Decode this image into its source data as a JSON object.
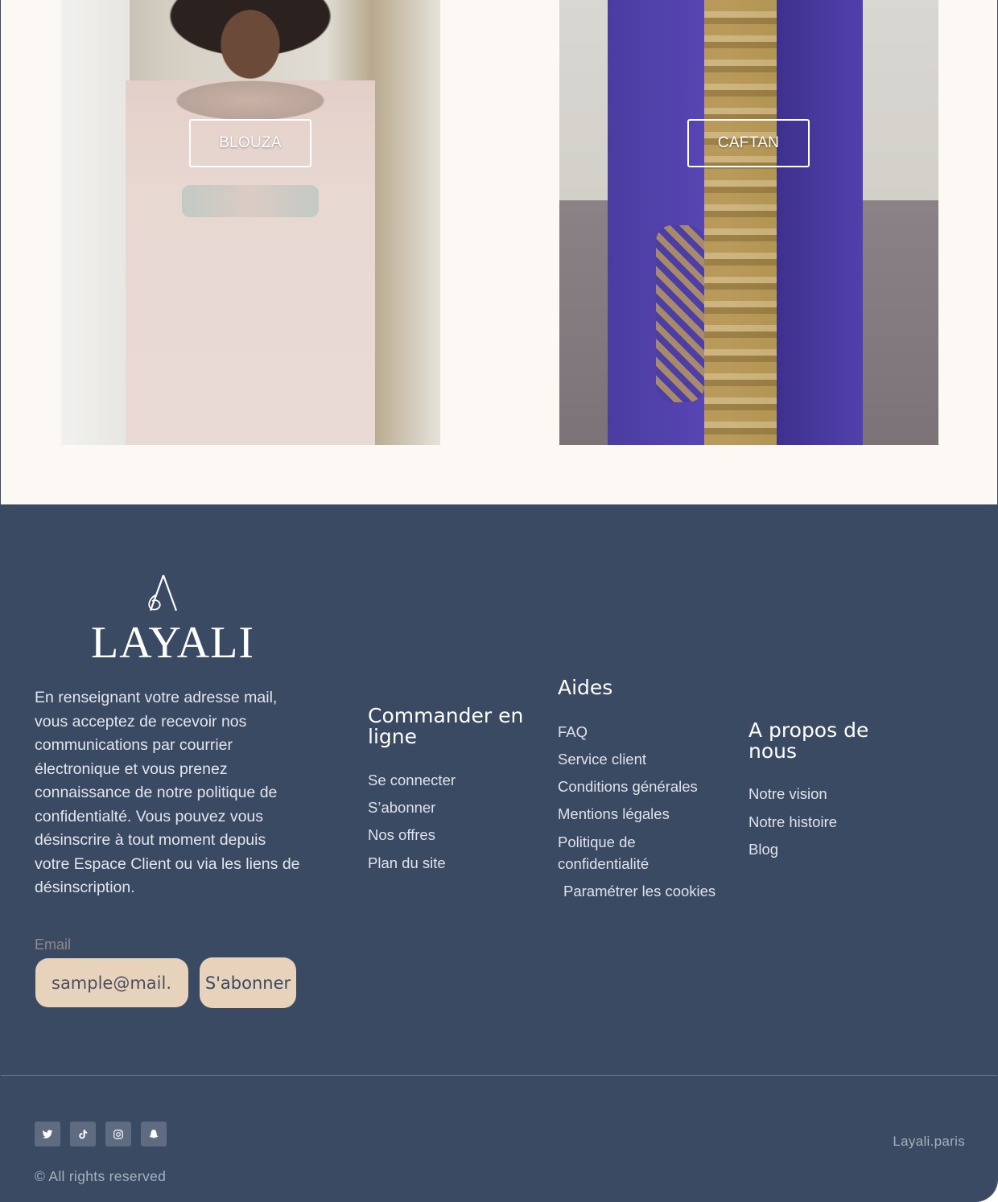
{
  "products": [
    {
      "label": "BLOUZA"
    },
    {
      "label": "CAFTAN"
    }
  ],
  "footer": {
    "logo_text": "LAYALI",
    "intro": "En renseignant votre adresse mail, vous acceptez de recevoir nos communications par courrier électronique et vous prenez connaissance de notre politique de confidentialté. Vous pouvez vous désinscrire à tout moment depuis votre Espace Client ou via les liens de désinscription.",
    "email_label": "Email",
    "email_placeholder": "sample@mail.com",
    "subscribe_label": "S'abonner",
    "columns": {
      "commander": {
        "title": "Commander en ligne",
        "links": [
          "Se connecter",
          "S’abonner",
          "Nos offres",
          "Plan du site"
        ]
      },
      "aides": {
        "title": "Aides",
        "links": [
          "FAQ",
          "Service client",
          "Conditions générales",
          "Mentions légales",
          "Politique de confidentialité",
          "Paramétrer les cookies"
        ]
      },
      "apropos": {
        "title": "A propos de nous",
        "links": [
          "Notre vision",
          "Notre histoire",
          "Blog"
        ]
      }
    },
    "socials": [
      "twitter-icon",
      "tiktok-icon",
      "instagram-icon",
      "snapchat-icon"
    ],
    "rights": "© All rights reserved",
    "brand_url": "Layali.paris"
  }
}
